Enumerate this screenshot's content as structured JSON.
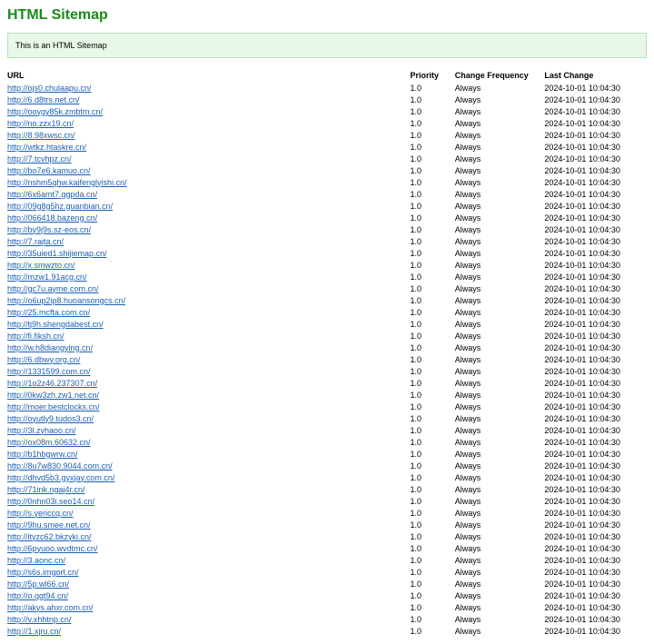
{
  "title": "HTML Sitemap",
  "notice": "This is an HTML Sitemap",
  "headers": {
    "url": "URL",
    "priority": "Priority",
    "freq": "Change Frequency",
    "last": "Last Change"
  },
  "default_priority": "1.0",
  "default_freq": "Always",
  "default_last": "2024-10-01 10:04:30",
  "urls": [
    "http://ojs0.chulaapu.cn/",
    "http://6.d8trs.net.cn/",
    "http://ooygy85k.zmbtm.cn/",
    "http://no.zzx19.cn/",
    "http://8.98xwsc.cn/",
    "http://wtkz.htaskre.cn/",
    "http://7.tcvhpz.cn/",
    "http://bo7e6.kamuo.cn/",
    "http://nshm5qhw.kaifenglyishi.cn/",
    "http://6x6amt7.ggpda.cn/",
    "http://09g8g5hz.guanbian.cn/",
    "http://066418.bazeng.cn/",
    "http://by9j9s.sz-eos.cn/",
    "http://7.rajta.cn/",
    "http://35uied1.shijiemap.cn/",
    "http://x.smwzto.cn/",
    "http://mzw1.91acg.cn/",
    "http://gc7u.ayme.com.cn/",
    "http://o6up2ip8.huoansongcs.cn/",
    "http://25.mcfta.com.cn/",
    "http://tj9h.shengdabest.cn/",
    "http://fi.fiksh.cn/",
    "http://w.h8diangying.cn/",
    "http://6.dbwy.org.cn/",
    "http://1331599.com.cn/",
    "http://1o2z46.237307.cn/",
    "http://0kw3zh.zw1.net.cn/",
    "http://moer.bestclocks.cn/",
    "http://oyutly9.tudos3.cn/",
    "http://3l.zyhaoo.cn/",
    "http://ox08m.60632.cn/",
    "http://b1hbgwrw.cn/",
    "http://8u7w830.9044.com.cn/",
    "http://dhvd5b3.gyxjay.com.cn/",
    "http://71ink.ngaj4r.cn/",
    "http://0nhn03i.seo14.cn/",
    "http://s.yericcq.cn/",
    "http://9hu.smee.net.cn/",
    "http://ityzc62.bkzyki.cn/",
    "http://6pyuoo.wvdtmc.cn/",
    "http://3.aonc.cn/",
    "http://s6s.imgort.cn/",
    "http://5p.wl66.cn/",
    "http://o.qgt94.cn/",
    "http://akys.ahxr.com.cn/",
    "http://v.xhhtnp.cn/",
    "http://1.xjru.cn/"
  ]
}
